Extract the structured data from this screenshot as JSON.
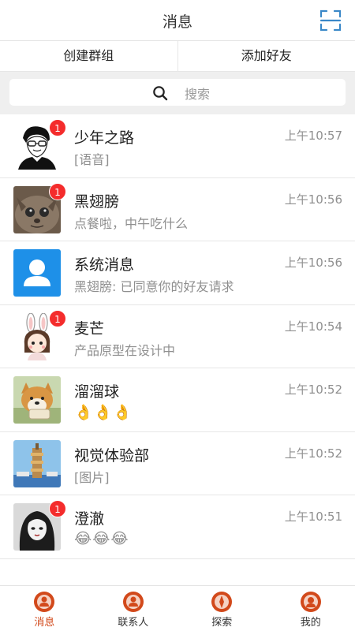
{
  "header": {
    "title": "消息",
    "scan_icon": "scan-icon"
  },
  "actions": {
    "create_group": "创建群组",
    "add_friend": "添加好友"
  },
  "search": {
    "placeholder": "搜索",
    "icon": "search-icon"
  },
  "conversations": [
    {
      "name": "少年之路",
      "preview": "[语音]",
      "time": "上午10:57",
      "badge": "1",
      "avatar": "boy-sketch-avatar"
    },
    {
      "name": "黑翅膀",
      "preview": "点餐啦，中午吃什么",
      "time": "上午10:56",
      "badge": "1",
      "avatar": "cat-photo-avatar"
    },
    {
      "name": "系统消息",
      "preview": "黑翅膀: 已同意你的好友请求",
      "time": "上午10:56",
      "badge": "",
      "avatar": "system-user-avatar"
    },
    {
      "name": "麦芒",
      "preview": "产品原型在设计中",
      "time": "上午10:54",
      "badge": "1",
      "avatar": "bunny-girl-avatar"
    },
    {
      "name": "溜溜球",
      "preview": "👌👌👌",
      "time": "上午10:52",
      "badge": "",
      "avatar": "shiba-dog-avatar"
    },
    {
      "name": "视觉体验部",
      "preview": "[图片]",
      "time": "上午10:52",
      "badge": "",
      "avatar": "tower-photo-avatar"
    },
    {
      "name": "澄澈",
      "preview": "😂😂😂",
      "time": "上午10:51",
      "badge": "1",
      "avatar": "dark-hair-girl-avatar"
    }
  ],
  "tabbar": [
    {
      "label": "消息",
      "icon": "message-tab-icon",
      "active": true
    },
    {
      "label": "联系人",
      "icon": "contacts-tab-icon",
      "active": false
    },
    {
      "label": "探索",
      "icon": "explore-tab-icon",
      "active": false
    },
    {
      "label": "我的",
      "icon": "profile-tab-icon",
      "active": false
    }
  ],
  "colors": {
    "badge": "#f42c2c",
    "accent": "#d2491b",
    "system_avatar": "#1e90e8",
    "scan_icon": "#3a88c8"
  }
}
